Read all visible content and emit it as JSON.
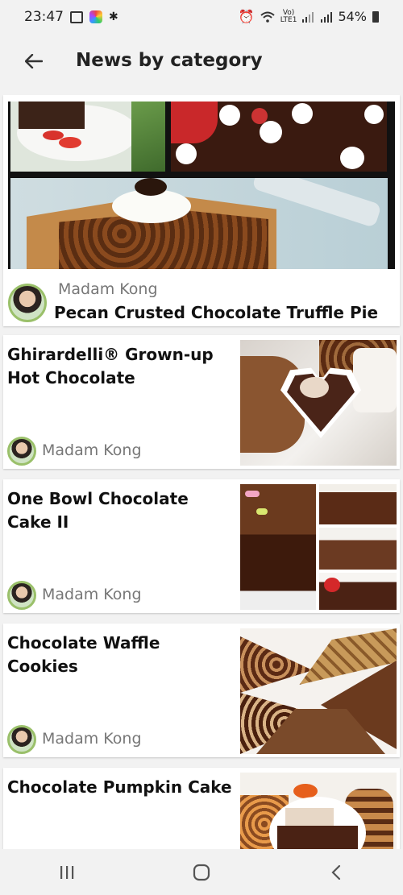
{
  "status_bar": {
    "time": "23:47",
    "battery": "54%",
    "icons": [
      "gallery-icon",
      "instagram-icon",
      "bug-icon",
      "alarm-icon",
      "wifi-icon",
      "volte-icon",
      "signal-icon",
      "signal-r-icon",
      "battery-icon"
    ]
  },
  "app_bar": {
    "back_icon": "arrow-left-icon",
    "title": "News by category"
  },
  "hero": {
    "author": "Madam Kong",
    "title": "Pecan Crusted Chocolate Truffle Pie"
  },
  "articles": [
    {
      "title": "Ghirardelli® Grown-up Hot Chocolate",
      "author": "Madam Kong"
    },
    {
      "title": "One Bowl Chocolate Cake II",
      "author": "Madam Kong"
    },
    {
      "title": "Chocolate Waffle Cookies",
      "author": "Madam Kong"
    },
    {
      "title": "Chocolate Pumpkin Cake",
      "author": ""
    }
  ],
  "nav_bar": {
    "icons": [
      "recents-icon",
      "home-icon",
      "back-icon"
    ]
  },
  "colors": {
    "background": "#f2f2f2",
    "card": "#ffffff",
    "text_primary": "#111111",
    "text_secondary": "#777777",
    "avatar_ring": "#9ac06a"
  }
}
